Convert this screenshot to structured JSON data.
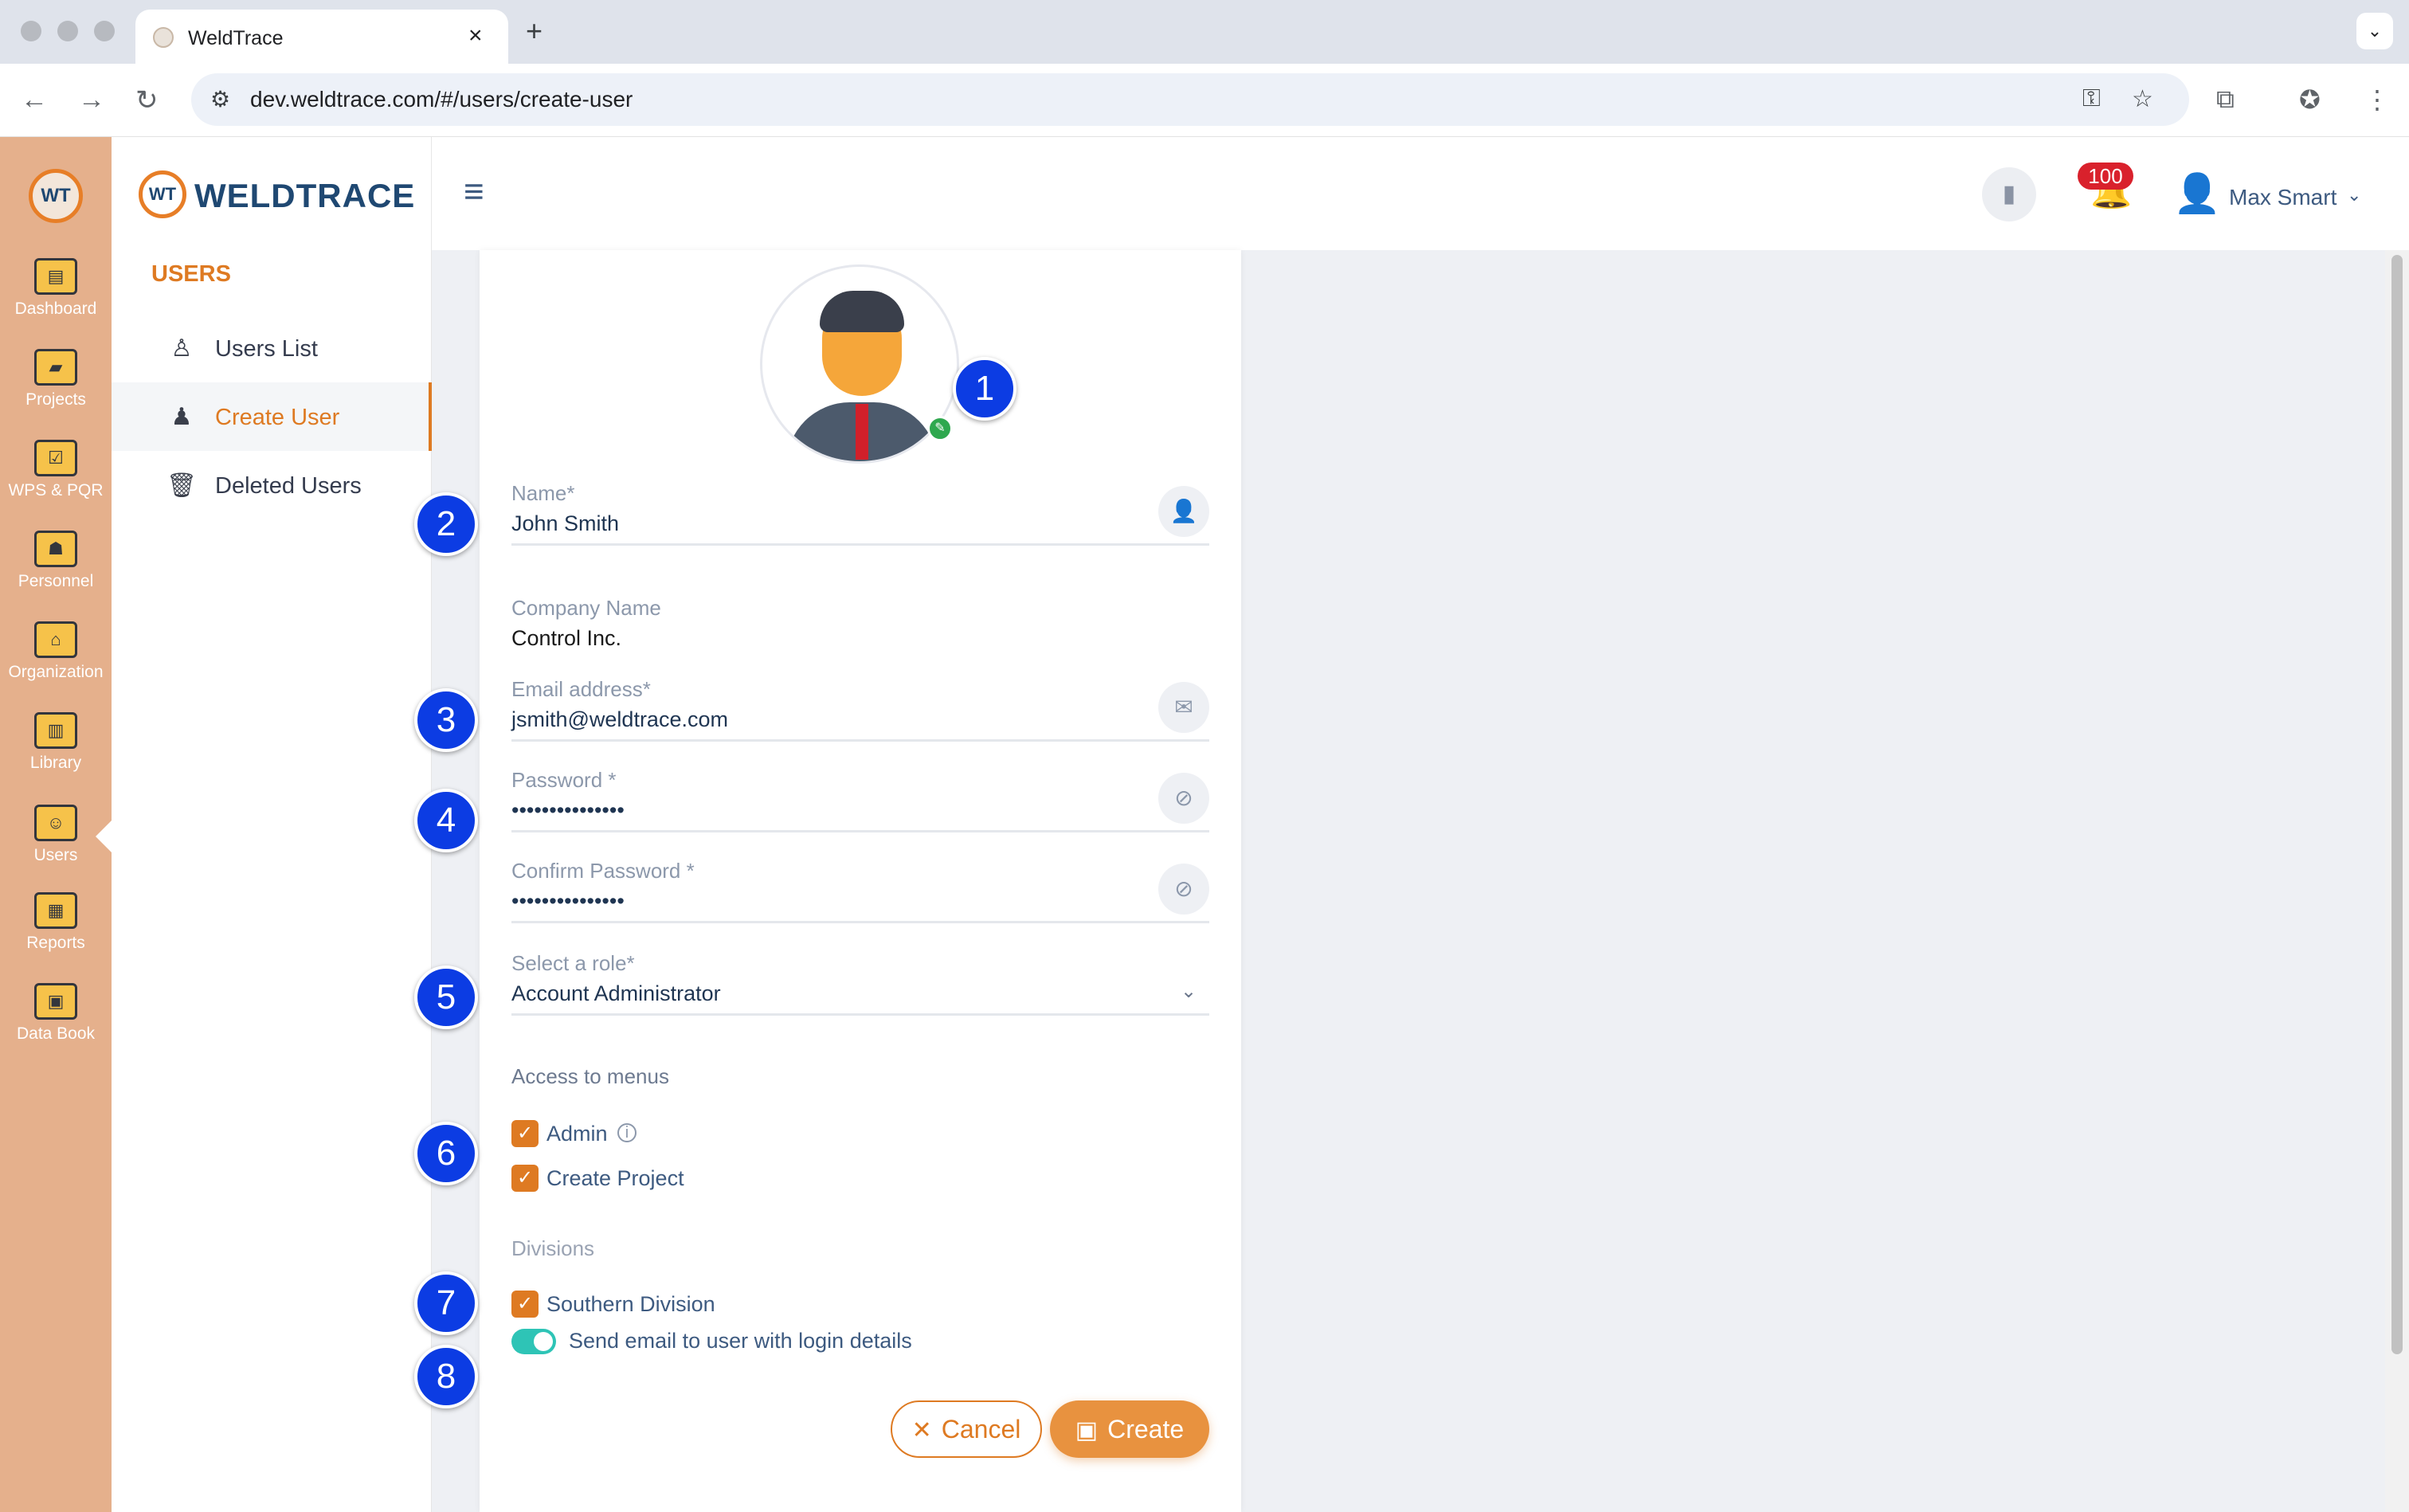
{
  "browser": {
    "tab_title": "WeldTrace",
    "url": "dev.weldtrace.com/#/users/create-user",
    "icons": [
      "back-icon",
      "forward-icon",
      "reload-icon",
      "site-settings-icon",
      "password-key-icon",
      "bookmark-star-icon",
      "extensions-icon",
      "profile-icon",
      "menu-icon"
    ]
  },
  "rail": {
    "logo": "WT",
    "items": [
      {
        "label": "Dashboard",
        "icon": "dashboard-icon",
        "glyph": "▤"
      },
      {
        "label": "Projects",
        "icon": "folder-icon",
        "glyph": "▰"
      },
      {
        "label": "WPS & PQR",
        "icon": "checklist-icon",
        "glyph": "☑"
      },
      {
        "label": "Personnel",
        "icon": "welder-icon",
        "glyph": "☗"
      },
      {
        "label": "Organization",
        "icon": "organization-icon",
        "glyph": "⌂"
      },
      {
        "label": "Library",
        "icon": "library-icon",
        "glyph": "▥"
      },
      {
        "label": "Users",
        "icon": "users-icon",
        "glyph": "☺"
      },
      {
        "label": "Reports",
        "icon": "reports-icon",
        "glyph": "▦"
      },
      {
        "label": "Data Book",
        "icon": "databook-icon",
        "glyph": "▣"
      }
    ]
  },
  "subnav": {
    "brand_mark": "WT",
    "brand": "WELDTRACE",
    "section_title": "USERS",
    "items": [
      {
        "label": "Users List",
        "icon": "users-list-icon",
        "glyph": "♙"
      },
      {
        "label": "Create User",
        "icon": "create-user-icon",
        "glyph": "♟"
      },
      {
        "label": "Deleted Users",
        "icon": "trash-icon",
        "glyph": "🗑"
      }
    ]
  },
  "topbar": {
    "notification_count": "100",
    "user_name": "Max Smart"
  },
  "form": {
    "name_label": "Name*",
    "name_value": "John Smith",
    "company_label": "Company Name",
    "company_value": "Control Inc.",
    "email_label": "Email address*",
    "email_value": "jsmith@weldtrace.com",
    "password_label": "Password *",
    "password_value": "•••••••••••••••",
    "confirm_label": "Confirm Password *",
    "confirm_value": "•••••••••••••••",
    "role_label": "Select a role*",
    "role_value": "Account Administrator",
    "access_label": "Access to menus",
    "access_items": [
      {
        "label": "Admin",
        "checked": true
      },
      {
        "label": "Create Project",
        "checked": true
      }
    ],
    "divisions_label": "Divisions",
    "divisions": [
      {
        "label": "Southern Division",
        "checked": true
      }
    ],
    "send_email_label": "Send email to user with login details",
    "send_email_on": true,
    "cancel_label": "Cancel",
    "create_label": "Create"
  },
  "callouts": [
    "1",
    "2",
    "3",
    "4",
    "5",
    "6",
    "7",
    "8"
  ],
  "colors": {
    "accent": "#de7a22",
    "rail": "#e5b08c",
    "brand_navy": "#1f4872",
    "callout": "#0c3ce3",
    "toggle": "#2ec4b6",
    "badge": "#d9212c"
  }
}
